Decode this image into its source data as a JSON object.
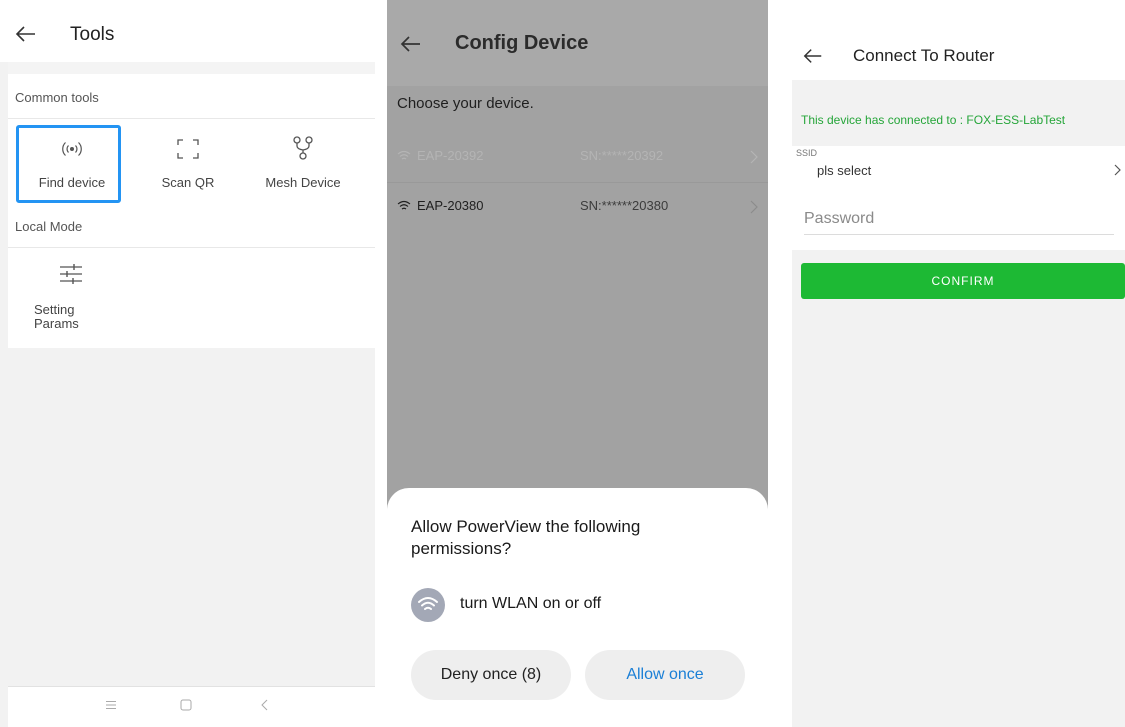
{
  "tools_screen": {
    "title": "Tools",
    "common_tools_label": "Common tools",
    "common_tools": [
      {
        "label": "Find device",
        "icon": "wireless-signal-icon",
        "selected": true
      },
      {
        "label": "Scan QR",
        "icon": "scan-frame-icon"
      },
      {
        "label": "Mesh Device",
        "icon": "mesh-network-icon"
      }
    ],
    "local_mode_label": "Local Mode",
    "local_tools": [
      {
        "label": "Setting Params",
        "icon": "sliders-icon"
      }
    ],
    "highlight_color": "#2394f3",
    "nav_bar": [
      "menu-icon",
      "home-icon",
      "back-icon"
    ]
  },
  "config_screen": {
    "title": "Config Device",
    "prompt": "Choose your device.",
    "devices": [
      {
        "name": "EAP-20392",
        "sn": "SN:*****20392",
        "dimmed": true
      },
      {
        "name": "EAP-20380",
        "sn": "SN:******20380",
        "dimmed": false
      }
    ],
    "permission_dialog": {
      "title": "Allow PowerView the following permissions?",
      "permission": "turn WLAN on or off",
      "deny_label": "Deny once (8)",
      "allow_label": "Allow once",
      "allow_color": "#1a7fd6"
    }
  },
  "router_screen": {
    "title": "Connect To Router",
    "status": "This device has connected to : FOX-ESS-LabTest",
    "status_color": "#25a539",
    "ssid_label": "SSID",
    "ssid_value": "pls select",
    "password_placeholder": "Password",
    "confirm_label": "CONFIRM",
    "confirm_color": "#1db934"
  }
}
